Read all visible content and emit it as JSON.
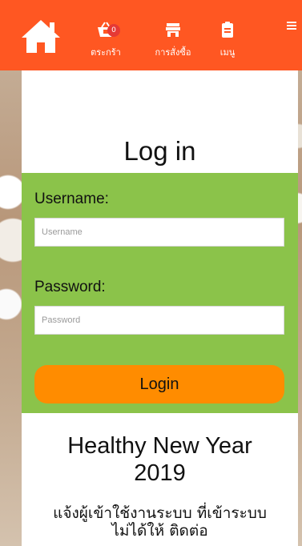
{
  "colors": {
    "navbar": "#ff5722",
    "form_bg": "#8bc34a",
    "login_button": "#ff8c00",
    "badge": "#e53935"
  },
  "navbar": {
    "home_icon": "home-icon",
    "items": [
      {
        "icon": "basket-icon",
        "label": "ตระกร้า",
        "badge": "0"
      },
      {
        "icon": "store-icon",
        "label": "การสั่งซื้อ"
      },
      {
        "icon": "clipboard-icon",
        "label": "เมนู"
      }
    ],
    "menu_icon": "hamburger-icon"
  },
  "login": {
    "title": "Log in",
    "username_label": "Username:",
    "username_placeholder": "Username",
    "password_label": "Password:",
    "password_placeholder": "Password",
    "button_label": "Login"
  },
  "announcement": {
    "headline_line1": "Healthy New Year",
    "headline_line2": "2019",
    "notice_line1": "แจ้งผู้เข้าใช้งานระบบ ที่เข้าระบบ",
    "notice_line2": "ไม่ได้ให้ ติดต่อ"
  }
}
